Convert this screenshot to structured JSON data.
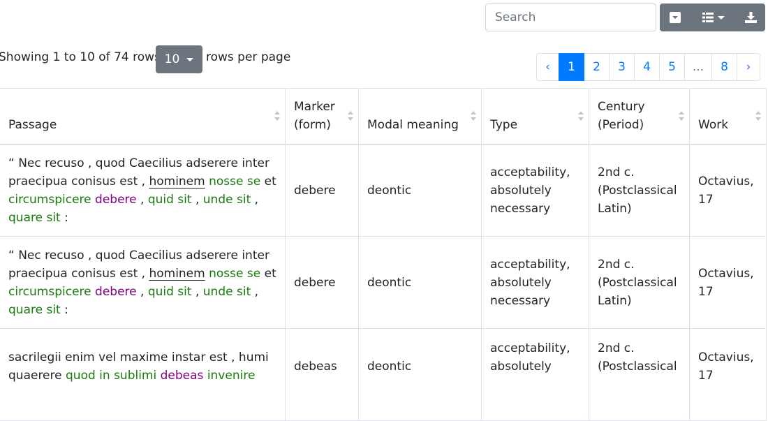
{
  "toolbar": {
    "search_placeholder": "Search",
    "buttons": [
      {
        "name": "card-view-toggle-button",
        "icon": "card-toggle-icon"
      },
      {
        "name": "columns-button",
        "icon": "columns-list-icon"
      },
      {
        "name": "export-button",
        "icon": "download-icon"
      }
    ]
  },
  "pagination_info": {
    "showing": "Showing 1 to 10 of 74 rows",
    "page_size": "10",
    "rows_per_page": "rows per page"
  },
  "pagination": [
    {
      "label": "‹",
      "active": false
    },
    {
      "label": "1",
      "active": true
    },
    {
      "label": "2",
      "active": false
    },
    {
      "label": "3",
      "active": false
    },
    {
      "label": "4",
      "active": false
    },
    {
      "label": "5",
      "active": false
    },
    {
      "label": "...",
      "active": false
    },
    {
      "label": "8",
      "active": false
    },
    {
      "label": "›",
      "active": false
    }
  ],
  "columns": [
    "Passage",
    "Marker\n(form)",
    "Modal meaning",
    "Type",
    "Century\n(Period)",
    "Work"
  ],
  "rows": [
    {
      "passage": [
        {
          "t": "“ Nec recuso , quod Caecilius adserere inter praecipua conisus est , ",
          "c": ""
        },
        {
          "t": "hominem",
          "c": "u"
        },
        {
          "t": " ",
          "c": ""
        },
        {
          "t": "nosse se",
          "c": "g"
        },
        {
          "t": " et ",
          "c": ""
        },
        {
          "t": "circumspicere",
          "c": "g"
        },
        {
          "t": " ",
          "c": ""
        },
        {
          "t": "debere",
          "c": "p"
        },
        {
          "t": " , ",
          "c": ""
        },
        {
          "t": "quid sit",
          "c": "g"
        },
        {
          "t": " , ",
          "c": ""
        },
        {
          "t": "unde sit",
          "c": "g"
        },
        {
          "t": " , ",
          "c": ""
        },
        {
          "t": "quare sit",
          "c": "g"
        },
        {
          "t": " :",
          "c": ""
        }
      ],
      "marker": "debere",
      "modal": "deontic",
      "type": "acceptability, absolutely necessary",
      "century": "2nd c. (Postclassical Latin)",
      "work": "Octavius, 17"
    },
    {
      "passage": [
        {
          "t": "“ Nec recuso , quod Caecilius adserere inter praecipua conisus est , ",
          "c": ""
        },
        {
          "t": "hominem",
          "c": "u"
        },
        {
          "t": " ",
          "c": ""
        },
        {
          "t": "nosse se",
          "c": "g"
        },
        {
          "t": " et ",
          "c": ""
        },
        {
          "t": "circumspicere",
          "c": "g"
        },
        {
          "t": " ",
          "c": ""
        },
        {
          "t": "debere",
          "c": "p"
        },
        {
          "t": " , ",
          "c": ""
        },
        {
          "t": "quid sit",
          "c": "g"
        },
        {
          "t": " , ",
          "c": ""
        },
        {
          "t": "unde sit",
          "c": "g"
        },
        {
          "t": " , ",
          "c": ""
        },
        {
          "t": "quare sit",
          "c": "g"
        },
        {
          "t": " :",
          "c": ""
        }
      ],
      "marker": "debere",
      "modal": "deontic",
      "type": "acceptability, absolutely necessary",
      "century": "2nd c. (Postclassical Latin)",
      "work": "Octavius, 17"
    },
    {
      "passage": [
        {
          "t": "sacrilegii enim vel maxime instar est , humi quaerere ",
          "c": ""
        },
        {
          "t": "quod in sublimi",
          "c": "g"
        },
        {
          "t": " ",
          "c": ""
        },
        {
          "t": "debeas",
          "c": "p"
        },
        {
          "t": " ",
          "c": ""
        },
        {
          "t": "invenire",
          "c": "g"
        }
      ],
      "marker": "debeas",
      "modal": "deontic",
      "type": "acceptability, absolutely",
      "century": "2nd c. (Postclassical",
      "work": "Octavius, 17"
    }
  ],
  "colors": {
    "accent": "#007bff",
    "button": "#6c757d",
    "highlight_green": "#1a7a0e",
    "highlight_purple": "#800080"
  }
}
